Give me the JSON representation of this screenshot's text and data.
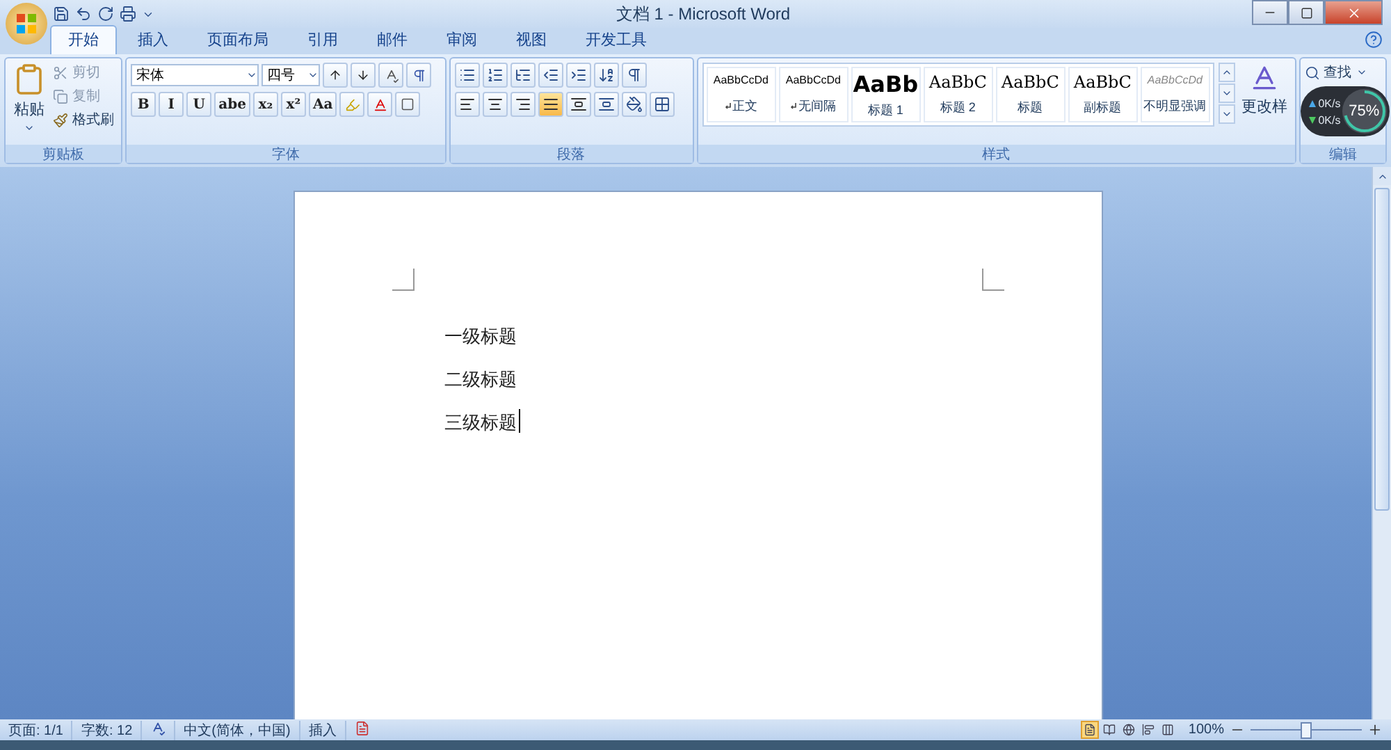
{
  "window": {
    "title": "文档 1 - Microsoft Word"
  },
  "tabs": [
    {
      "label": "开始",
      "selected": true
    },
    {
      "label": "插入",
      "selected": false
    },
    {
      "label": "页面布局",
      "selected": false
    },
    {
      "label": "引用",
      "selected": false
    },
    {
      "label": "邮件",
      "selected": false
    },
    {
      "label": "审阅",
      "selected": false
    },
    {
      "label": "视图",
      "selected": false
    },
    {
      "label": "开发工具",
      "selected": false
    }
  ],
  "clipboard": {
    "label": "剪贴板",
    "paste": "粘贴",
    "items": [
      {
        "label": "剪切",
        "disabled": true
      },
      {
        "label": "复制",
        "disabled": true
      },
      {
        "label": "格式刷",
        "disabled": false
      }
    ]
  },
  "font": {
    "label": "字体",
    "name": "宋体",
    "size": "四号",
    "format_buttons": [
      "B",
      "I",
      "U",
      "abe",
      "x₂",
      "x²",
      "Aa"
    ]
  },
  "paragraph": {
    "label": "段落",
    "align": [
      {
        "selected": false
      },
      {
        "selected": false
      },
      {
        "selected": false
      },
      {
        "selected": true
      },
      {
        "selected": false
      }
    ]
  },
  "styles": {
    "label": "样式",
    "items": [
      {
        "preview": "AaBbCcDd",
        "name": "正文",
        "kind": "small",
        "paragraph_mark": true
      },
      {
        "preview": "AaBbCcDd",
        "name": "无间隔",
        "kind": "small",
        "paragraph_mark": true
      },
      {
        "preview": "AaBb",
        "name": "标题 1",
        "kind": "heading1",
        "paragraph_mark": false
      },
      {
        "preview": "AaBbC",
        "name": "标题 2",
        "kind": "heading",
        "paragraph_mark": false
      },
      {
        "preview": "AaBbC",
        "name": "标题",
        "kind": "heading",
        "paragraph_mark": false
      },
      {
        "preview": "AaBbC",
        "name": "副标题",
        "kind": "heading",
        "paragraph_mark": false
      },
      {
        "preview": "AaBbCcDd",
        "name": "不明显强调",
        "kind": "subtle",
        "paragraph_mark": false
      }
    ],
    "change_label": "更改样"
  },
  "editing": {
    "label": "编辑",
    "find": "查找"
  },
  "overlay": {
    "upload": "0K/s",
    "download": "0K/s",
    "percent": "75%"
  },
  "document": {
    "lines": [
      {
        "text": "一级标题",
        "cursor": false
      },
      {
        "text": "二级标题",
        "cursor": false
      },
      {
        "text": "三级标题",
        "cursor": true
      }
    ]
  },
  "status_bar": {
    "page": "页面: 1/1",
    "words": "字数: 12",
    "language": "中文(简体，中国)",
    "mode": "插入",
    "views": [
      {
        "selected": true
      },
      {
        "selected": false
      },
      {
        "selected": false
      },
      {
        "selected": false
      },
      {
        "selected": false
      }
    ],
    "zoom": "100%",
    "zoom_slider": {
      "level": 0.5
    }
  }
}
